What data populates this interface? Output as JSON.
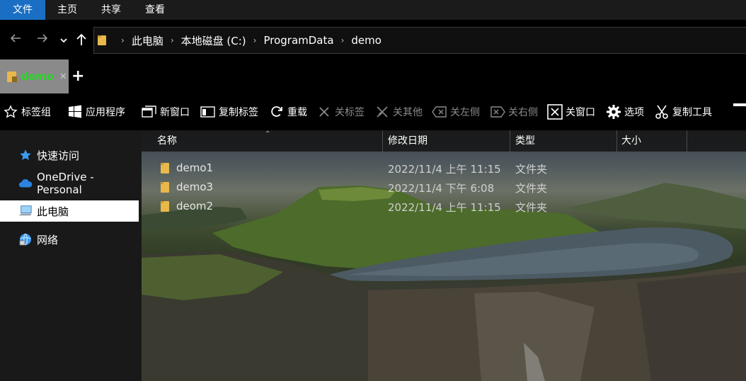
{
  "ribbon": {
    "tabs": [
      {
        "label": "文件",
        "active": true
      },
      {
        "label": "主页",
        "active": false
      },
      {
        "label": "共享",
        "active": false
      },
      {
        "label": "查看",
        "active": false
      }
    ]
  },
  "nav": {
    "back_icon": "arrow-left-icon",
    "forward_icon": "arrow-right-icon",
    "recent_icon": "chevron-down-icon",
    "up_icon": "arrow-up-icon",
    "breadcrumb": [
      "此电脑",
      "本地磁盘 (C:)",
      "ProgramData",
      "demo"
    ]
  },
  "tabs": {
    "items": [
      {
        "label": "demo",
        "icon": "folder-icon"
      }
    ],
    "add_label": "+"
  },
  "toolbar": {
    "items": [
      {
        "label": "标签组",
        "icon": "star-icon",
        "enabled": true
      },
      {
        "label": "应用程序",
        "icon": "windows-icon",
        "enabled": true
      },
      {
        "label": "新窗口",
        "icon": "new-window-icon",
        "enabled": true
      },
      {
        "label": "复制标签",
        "icon": "duplicate-tab-icon",
        "enabled": true
      },
      {
        "label": "重载",
        "icon": "reload-icon",
        "enabled": true
      },
      {
        "label": "关标签",
        "icon": "close-x-icon",
        "enabled": false
      },
      {
        "label": "关其他",
        "icon": "close-others-icon",
        "enabled": false
      },
      {
        "label": "关左侧",
        "icon": "close-left-icon",
        "enabled": false
      },
      {
        "label": "关右侧",
        "icon": "close-right-icon",
        "enabled": false
      },
      {
        "label": "关窗口",
        "icon": "close-window-icon",
        "enabled": true
      },
      {
        "label": "选项",
        "icon": "gear-icon",
        "enabled": true
      },
      {
        "label": "复制工具",
        "icon": "scissors-icon",
        "enabled": true
      }
    ]
  },
  "sidebar": {
    "items": [
      {
        "label": "快速访问",
        "icon": "star-icon",
        "selected": false
      },
      {
        "label": "OneDrive - Personal",
        "icon": "cloud-icon",
        "selected": false
      },
      {
        "label": "此电脑",
        "icon": "computer-icon",
        "selected": true
      },
      {
        "label": "网络",
        "icon": "network-icon",
        "selected": false
      }
    ]
  },
  "files": {
    "columns": [
      "名称",
      "修改日期",
      "类型",
      "大小"
    ],
    "rows": [
      {
        "name": "demo1",
        "date": "2022/11/4 上午 11:15",
        "type": "文件夹",
        "size": ""
      },
      {
        "name": "demo3",
        "date": "2022/11/4 下午 6:08",
        "type": "文件夹",
        "size": ""
      },
      {
        "name": "deom2",
        "date": "2022/11/4 上午 11:15",
        "type": "文件夹",
        "size": ""
      }
    ]
  },
  "colors": {
    "accent": "#1a6fc4",
    "tab_label": "#2bd52b",
    "folder": "#e8b84a"
  }
}
